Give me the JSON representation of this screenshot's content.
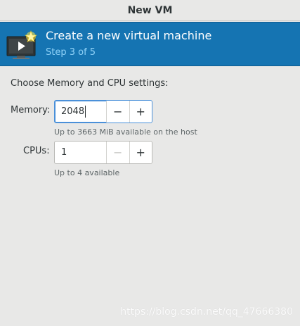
{
  "window": {
    "title": "New VM"
  },
  "header": {
    "title": "Create a new virtual machine",
    "step": "Step 3 of 5",
    "icon": "new-vm-monitor-icon"
  },
  "section": {
    "label": "Choose Memory and CPU settings:"
  },
  "memory": {
    "label": "Memory:",
    "value": "2048",
    "decrement": "−",
    "increment": "+",
    "hint": "Up to 3663 MiB available on the host"
  },
  "cpus": {
    "label": "CPUs:",
    "value": "1",
    "decrement": "−",
    "increment": "+",
    "hint": "Up to 4 available"
  },
  "watermark": "https://blog.csdn.net/qq_47666380",
  "colors": {
    "header_bg": "#1574b2",
    "step_text": "#8fd2f8",
    "focus": "#4a90d9"
  }
}
